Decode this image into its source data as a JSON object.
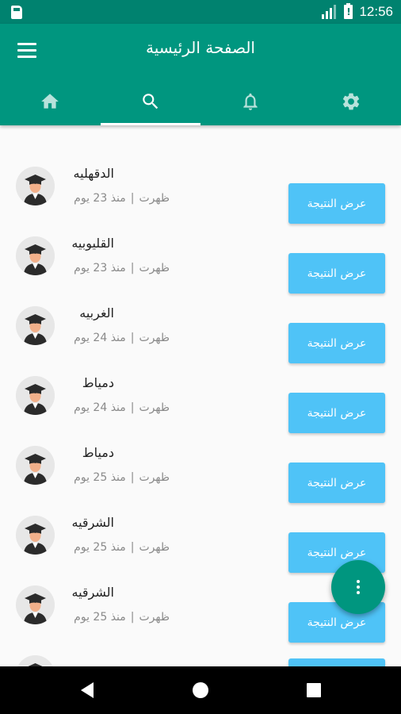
{
  "status_bar": {
    "time": "12:56",
    "icons": [
      "sim-card-icon",
      "signal-icon",
      "battery-alert-icon"
    ]
  },
  "app_bar": {
    "title": "الصفحة الرئيسية",
    "menu_icon": "hamburger-menu-icon",
    "tabs": [
      {
        "icon": "home-icon",
        "active": false
      },
      {
        "icon": "search-icon",
        "active": true
      },
      {
        "icon": "bell-icon",
        "active": false
      },
      {
        "icon": "gear-icon",
        "active": false
      }
    ]
  },
  "results": [
    {
      "name": "الدقهليه",
      "status": "ظهرت",
      "age": "منذ 23 يوم",
      "button": "عرض النتيجة"
    },
    {
      "name": "القليوبيه",
      "status": "ظهرت",
      "age": "منذ 23 يوم",
      "button": "عرض النتيجة"
    },
    {
      "name": "الغربيه",
      "status": "ظهرت",
      "age": "منذ 24 يوم",
      "button": "عرض النتيجة"
    },
    {
      "name": "دمياط",
      "status": "ظهرت",
      "age": "منذ 24 يوم",
      "button": "عرض النتيجة"
    },
    {
      "name": "دمياط",
      "status": "ظهرت",
      "age": "منذ 25 يوم",
      "button": "عرض النتيجة"
    },
    {
      "name": "الشرقيه",
      "status": "ظهرت",
      "age": "منذ 25 يوم",
      "button": "عرض النتيجة"
    },
    {
      "name": "الشرقيه",
      "status": "ظهرت",
      "age": "منذ 25 يوم",
      "button": "عرض النتيجة"
    }
  ],
  "separator": "|",
  "fab_icon": "more-vertical-icon",
  "nav_bar": [
    "back-icon",
    "home-circle-icon",
    "recents-square-icon"
  ],
  "colors": {
    "primary": "#00967f",
    "primary_dark": "#00826f",
    "button": "#4fc3f7",
    "background": "#fafafa"
  }
}
